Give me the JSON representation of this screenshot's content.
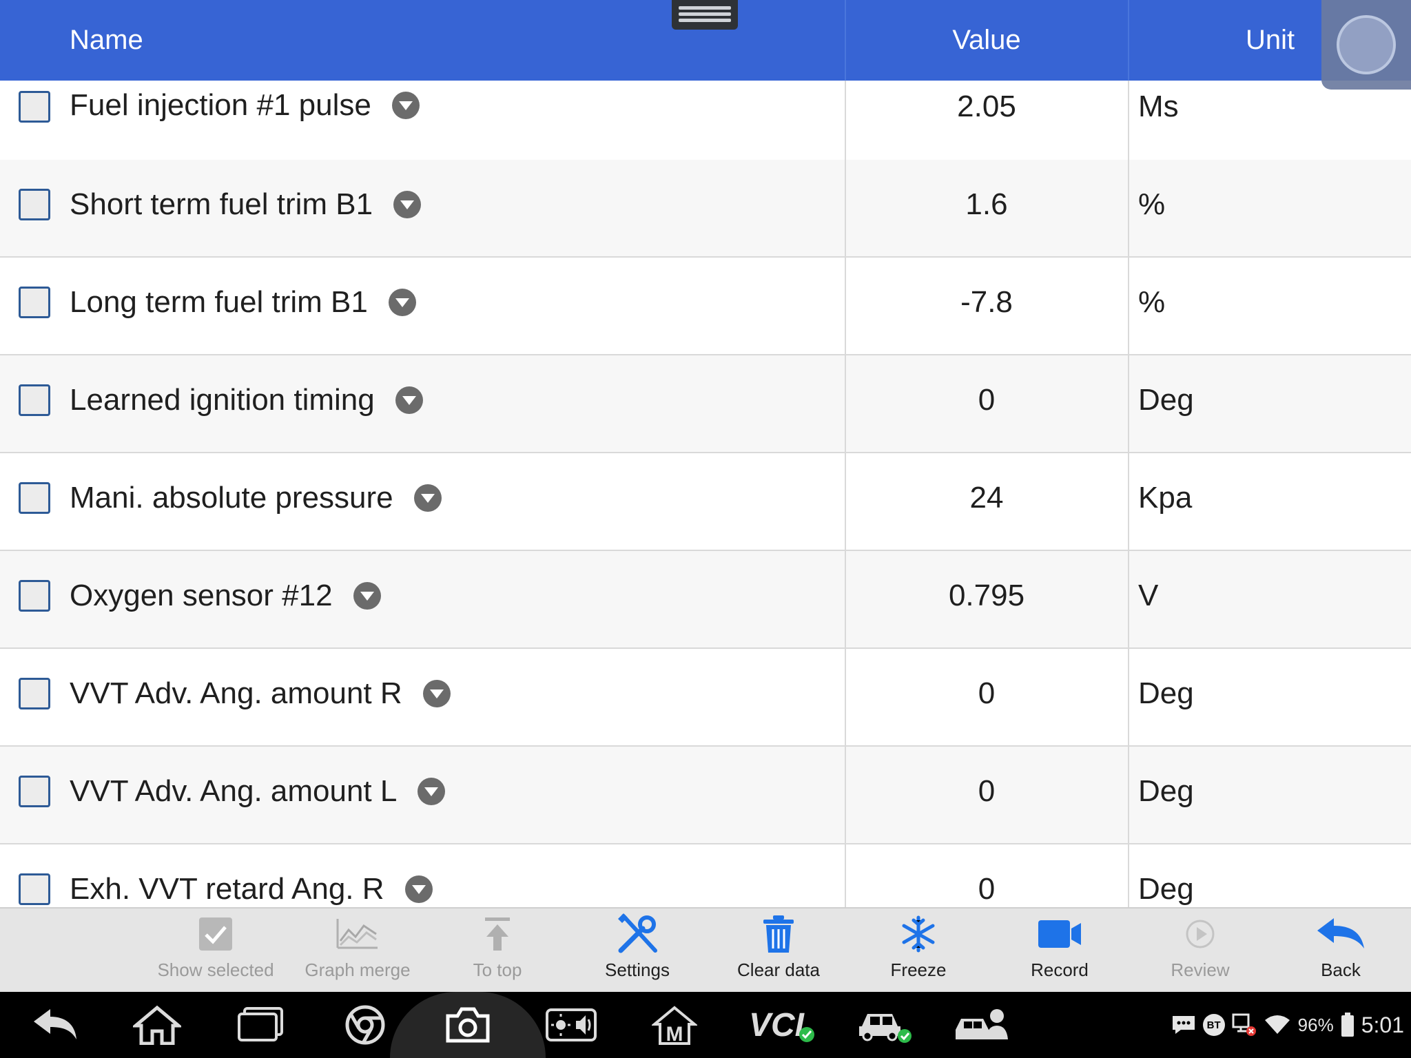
{
  "header": {
    "name_label": "Name",
    "value_label": "Value",
    "unit_label": "Unit"
  },
  "rows": [
    {
      "name": "Fuel injection #1 pulse",
      "value": "2.05",
      "unit": "Ms",
      "checked": false
    },
    {
      "name": "Short term fuel trim B1",
      "value": "1.6",
      "unit": "%",
      "checked": false
    },
    {
      "name": "Long term fuel trim B1",
      "value": "-7.8",
      "unit": "%",
      "checked": false
    },
    {
      "name": "Learned ignition timing",
      "value": "0",
      "unit": "Deg",
      "checked": false
    },
    {
      "name": "Mani. absolute pressure",
      "value": "24",
      "unit": "Kpa",
      "checked": false
    },
    {
      "name": "Oxygen sensor #12",
      "value": "0.795",
      "unit": "V",
      "checked": false
    },
    {
      "name": "VVT Adv. Ang. amount R",
      "value": "0",
      "unit": "Deg",
      "checked": false
    },
    {
      "name": "VVT Adv. Ang. amount L",
      "value": "0",
      "unit": "Deg",
      "checked": false
    },
    {
      "name": "Exh. VVT retard Ang. R",
      "value": "0",
      "unit": "Deg",
      "checked": false
    }
  ],
  "toolbar": {
    "show_selected": "Show selected",
    "graph_merge": "Graph merge",
    "to_top": "To top",
    "settings": "Settings",
    "clear_data": "Clear data",
    "freeze": "Freeze",
    "record": "Record",
    "review": "Review",
    "back": "Back"
  },
  "status": {
    "bt": "BT",
    "battery": "96%",
    "time": "5:01",
    "vci": "VCI"
  },
  "colors": {
    "header_bg": "#3764d4",
    "accent_blue": "#1e73e8",
    "checkbox_border": "#2d5a96"
  }
}
